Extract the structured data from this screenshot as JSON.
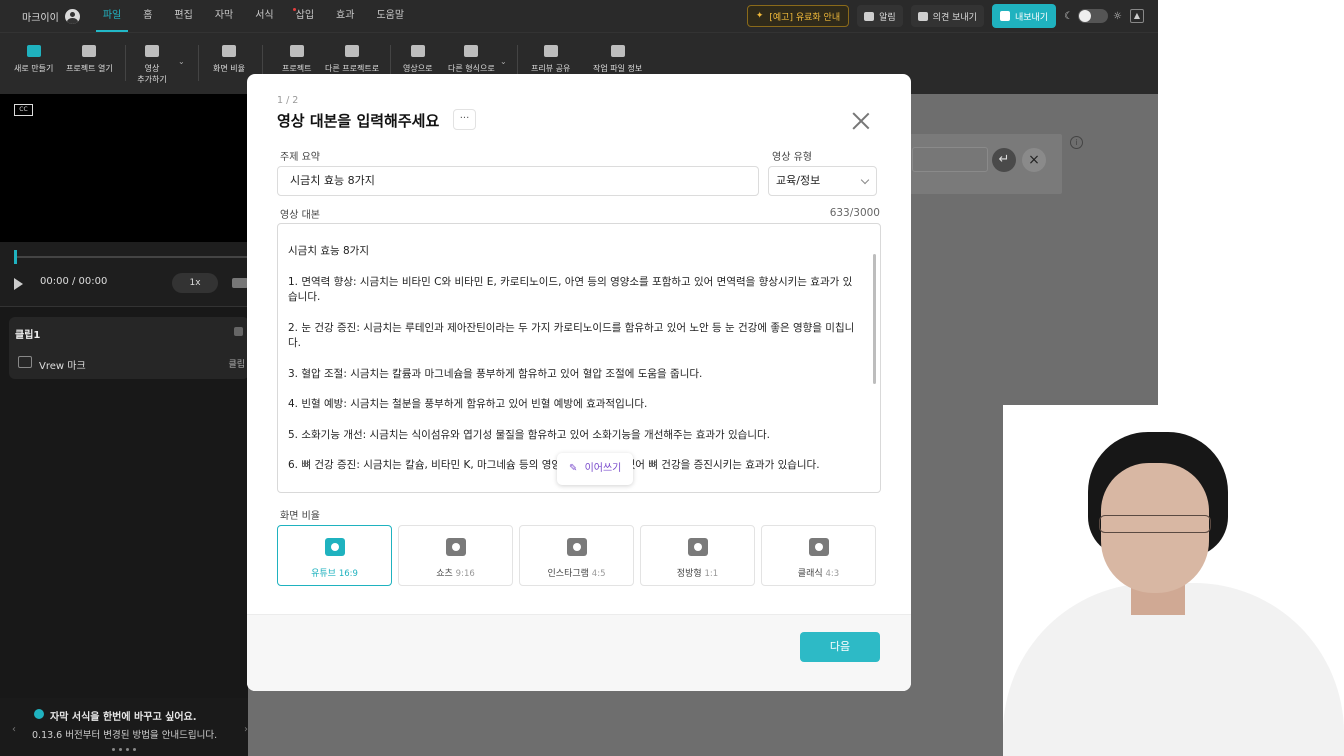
{
  "menubar": {
    "profile_name": "마크이이",
    "items": [
      "파일",
      "홈",
      "편집",
      "자막",
      "서식",
      "삽입",
      "효과",
      "도움말"
    ],
    "active_index": 0,
    "notice_label": "[예고] 유료화 안내",
    "alarm_label": "알림",
    "feedback_label": "의견 보내기",
    "export_label": "내보내기"
  },
  "toolbar": {
    "tools": [
      {
        "label": "새로 만들기",
        "icon": "new-project-icon"
      },
      {
        "label": "프로젝트 열기",
        "icon": "open-project-icon"
      },
      {
        "label": "영상\n추가하기",
        "icon": "add-video-icon"
      },
      {
        "label": "화면 비율",
        "icon": "aspect-ratio-icon"
      },
      {
        "label": "프로젝트",
        "icon": "export-project-icon"
      },
      {
        "label": "다른 프로젝트로",
        "icon": "other-project-icon"
      },
      {
        "label": "영상으로",
        "icon": "export-video-icon"
      },
      {
        "label": "다른 형식으로",
        "icon": "other-format-icon"
      },
      {
        "label": "프리뷰 공유",
        "icon": "link-icon"
      },
      {
        "label": "작업 파일 정보",
        "icon": "file-info-icon"
      }
    ]
  },
  "player": {
    "cc_label": "CC",
    "time": "00:00 / 00:00",
    "speed": "1x"
  },
  "clip": {
    "title": "클립1",
    "row_label": "Vrew 마크",
    "row_right": "클립"
  },
  "tip": {
    "title": "자막 서식을 한번에 바꾸고 싶어요.",
    "subtitle": "0.13.6 버전부터 변경된 방법을 안내드립니다."
  },
  "modal": {
    "step": "1 / 2",
    "title": "영상 대본을 입력해주세요",
    "more_label": "···",
    "topic_label": "주제 요약",
    "topic_value": "시금치 효능 8가지",
    "type_label": "영상 유형",
    "type_value": "교육/정보",
    "script_label": "영상 대본",
    "counter": "633/3000",
    "script_lines": [
      "시금치 효능 8가지",
      "1. 면역력 향상: 시금치는 비타민 C와 비타민 E, 카로티노이드, 아연 등의 영양소를 포함하고 있어 면역력을 향상시키는 효과가 있습니다.",
      "2. 눈 건강 증진: 시금치는 루테인과 제아잔틴이라는 두 가지 카로티노이드를 함유하고 있어 노안 등 눈 건강에 좋은 영향을 미칩니다.",
      "3. 혈압 조절: 시금치는 칼륨과 마그네슘을 풍부하게 함유하고 있어 혈압 조절에 도움을 줍니다.",
      "4. 빈혈 예방: 시금치는 철분을 풍부하게 함유하고 있어 빈혈 예방에 효과적입니다.",
      "5. 소화기능 개선: 시금치는 식이섬유와 엽기성 물질을 함유하고 있어 소화기능을 개선해주는 효과가 있습니다.",
      "6. 뼈 건강 증진: 시금치는 칼슘, 비타민 K, 마그네슘 등의 영양소를 함유하고 있어 뼈 건강을 증진시키는 효과가 있습니다."
    ],
    "continue_label": "이어쓰기",
    "ratio_label": "화면 비율",
    "ratios": [
      {
        "name": "유튜브",
        "ratio": "16:9"
      },
      {
        "name": "쇼츠",
        "ratio": "9:16"
      },
      {
        "name": "인스타그램",
        "ratio": "4:5"
      },
      {
        "name": "정방형",
        "ratio": "1:1"
      },
      {
        "name": "클래식",
        "ratio": "4:3"
      }
    ],
    "active_ratio_index": 0,
    "next_label": "다음"
  },
  "colors": {
    "accent": "#1fb2bf",
    "next_button": "#2dbac6",
    "continue_text": "#7a4ccc",
    "notice": "#f0b93a"
  }
}
